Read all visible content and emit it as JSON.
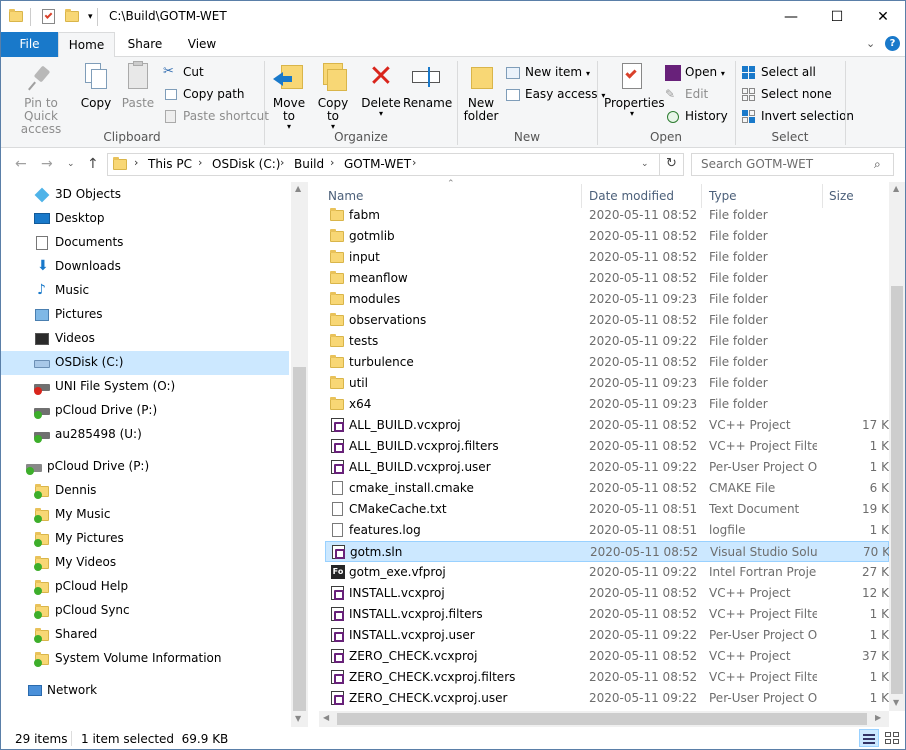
{
  "window": {
    "title": "C:\\Build\\GOTM-WET",
    "minimize": "—",
    "maximize": "☐",
    "close": "✕"
  },
  "ribbon_tabs": [
    "File",
    "Home",
    "Share",
    "View"
  ],
  "ribbon": {
    "clipboard": {
      "label": "Clipboard",
      "pin": "Pin to Quick access",
      "copy": "Copy",
      "paste": "Paste",
      "cut": "Cut",
      "copy_path": "Copy path",
      "paste_shortcut": "Paste shortcut"
    },
    "organize": {
      "label": "Organize",
      "move_to": "Move to",
      "copy_to": "Copy to",
      "delete": "Delete",
      "rename": "Rename"
    },
    "new": {
      "label": "New",
      "new_folder": "New folder",
      "new_item": "New item",
      "easy_access": "Easy access"
    },
    "open": {
      "label": "Open",
      "properties": "Properties",
      "open": "Open",
      "edit": "Edit",
      "history": "History"
    },
    "select": {
      "label": "Select",
      "select_all": "Select all",
      "select_none": "Select none",
      "invert_selection": "Invert selection"
    }
  },
  "address": {
    "crumbs": [
      "This PC",
      "OSDisk (C:)",
      "Build",
      "GOTM-WET"
    ],
    "search_placeholder": "Search GOTM-WET"
  },
  "nav": {
    "items": [
      {
        "label": "3D Objects",
        "icon": "3d-objects-icon"
      },
      {
        "label": "Desktop",
        "icon": "desktop-icon"
      },
      {
        "label": "Documents",
        "icon": "documents-icon"
      },
      {
        "label": "Downloads",
        "icon": "downloads-icon"
      },
      {
        "label": "Music",
        "icon": "music-icon"
      },
      {
        "label": "Pictures",
        "icon": "pictures-icon"
      },
      {
        "label": "Videos",
        "icon": "videos-icon"
      },
      {
        "label": "OSDisk (C:)",
        "icon": "drive-icon"
      },
      {
        "label": "UNI File System (O:)",
        "icon": "network-drive-icon"
      },
      {
        "label": "pCloud Drive (P:)",
        "icon": "network-drive-icon"
      },
      {
        "label": "au285498 (U:)",
        "icon": "network-drive-icon"
      },
      {
        "label": "pCloud Drive (P:)",
        "icon": "cloud-drive-icon"
      },
      {
        "label": "Dennis",
        "icon": "cloud-folder-icon"
      },
      {
        "label": "My Music",
        "icon": "cloud-folder-icon"
      },
      {
        "label": "My Pictures",
        "icon": "cloud-folder-icon"
      },
      {
        "label": "My Videos",
        "icon": "cloud-folder-icon"
      },
      {
        "label": "pCloud Help",
        "icon": "cloud-folder-icon"
      },
      {
        "label": "pCloud Sync",
        "icon": "cloud-folder-icon"
      },
      {
        "label": "Shared",
        "icon": "cloud-folder-icon"
      },
      {
        "label": "System Volume Information",
        "icon": "cloud-folder-icon"
      },
      {
        "label": "Network",
        "icon": "network-icon"
      }
    ]
  },
  "columns": {
    "name": "Name",
    "date": "Date modified",
    "type": "Type",
    "size": "Size"
  },
  "files": [
    {
      "name": "fabm",
      "date": "2020-05-11 08:52",
      "type": "File folder",
      "size": "",
      "kind": "folder"
    },
    {
      "name": "gotmlib",
      "date": "2020-05-11 08:52",
      "type": "File folder",
      "size": "",
      "kind": "folder"
    },
    {
      "name": "input",
      "date": "2020-05-11 08:52",
      "type": "File folder",
      "size": "",
      "kind": "folder"
    },
    {
      "name": "meanflow",
      "date": "2020-05-11 08:52",
      "type": "File folder",
      "size": "",
      "kind": "folder"
    },
    {
      "name": "modules",
      "date": "2020-05-11 09:23",
      "type": "File folder",
      "size": "",
      "kind": "folder"
    },
    {
      "name": "observations",
      "date": "2020-05-11 08:52",
      "type": "File folder",
      "size": "",
      "kind": "folder"
    },
    {
      "name": "tests",
      "date": "2020-05-11 09:22",
      "type": "File folder",
      "size": "",
      "kind": "folder"
    },
    {
      "name": "turbulence",
      "date": "2020-05-11 08:52",
      "type": "File folder",
      "size": "",
      "kind": "folder"
    },
    {
      "name": "util",
      "date": "2020-05-11 09:23",
      "type": "File folder",
      "size": "",
      "kind": "folder"
    },
    {
      "name": "x64",
      "date": "2020-05-11 09:23",
      "type": "File folder",
      "size": "",
      "kind": "folder"
    },
    {
      "name": "ALL_BUILD.vcxproj",
      "date": "2020-05-11 08:52",
      "type": "VC++ Project",
      "size": "17 K",
      "kind": "vs"
    },
    {
      "name": "ALL_BUILD.vcxproj.filters",
      "date": "2020-05-11 08:52",
      "type": "VC++ Project Filte...",
      "size": "1 K",
      "kind": "vs"
    },
    {
      "name": "ALL_BUILD.vcxproj.user",
      "date": "2020-05-11 09:22",
      "type": "Per-User Project O...",
      "size": "1 K",
      "kind": "vs"
    },
    {
      "name": "cmake_install.cmake",
      "date": "2020-05-11 08:52",
      "type": "CMAKE File",
      "size": "6 K",
      "kind": "doc"
    },
    {
      "name": "CMakeCache.txt",
      "date": "2020-05-11 08:51",
      "type": "Text Document",
      "size": "19 K",
      "kind": "doc"
    },
    {
      "name": "features.log",
      "date": "2020-05-11 08:51",
      "type": "logfile",
      "size": "1 K",
      "kind": "doc"
    },
    {
      "name": "gotm.sln",
      "date": "2020-05-11 08:52",
      "type": "Visual Studio Solu...",
      "size": "70 K",
      "kind": "vs"
    },
    {
      "name": "gotm_exe.vfproj",
      "date": "2020-05-11 09:22",
      "type": "Intel Fortran Proje...",
      "size": "27 K",
      "kind": "fo"
    },
    {
      "name": "INSTALL.vcxproj",
      "date": "2020-05-11 08:52",
      "type": "VC++ Project",
      "size": "12 K",
      "kind": "vs"
    },
    {
      "name": "INSTALL.vcxproj.filters",
      "date": "2020-05-11 08:52",
      "type": "VC++ Project Filte...",
      "size": "1 K",
      "kind": "vs"
    },
    {
      "name": "INSTALL.vcxproj.user",
      "date": "2020-05-11 09:22",
      "type": "Per-User Project O...",
      "size": "1 K",
      "kind": "vs"
    },
    {
      "name": "ZERO_CHECK.vcxproj",
      "date": "2020-05-11 08:52",
      "type": "VC++ Project",
      "size": "37 K",
      "kind": "vs"
    },
    {
      "name": "ZERO_CHECK.vcxproj.filters",
      "date": "2020-05-11 08:52",
      "type": "VC++ Project Filte...",
      "size": "1 K",
      "kind": "vs"
    },
    {
      "name": "ZERO_CHECK.vcxproj.user",
      "date": "2020-05-11 09:22",
      "type": "Per-User Project O...",
      "size": "1 K",
      "kind": "vs"
    }
  ],
  "status": {
    "count": "29 items",
    "selected": "1 item selected  69.9 KB"
  },
  "colors": {
    "accent": "#1979ca",
    "selection": "#cce8ff",
    "selection_border": "#99d1ff",
    "folder": "#f8d775"
  }
}
